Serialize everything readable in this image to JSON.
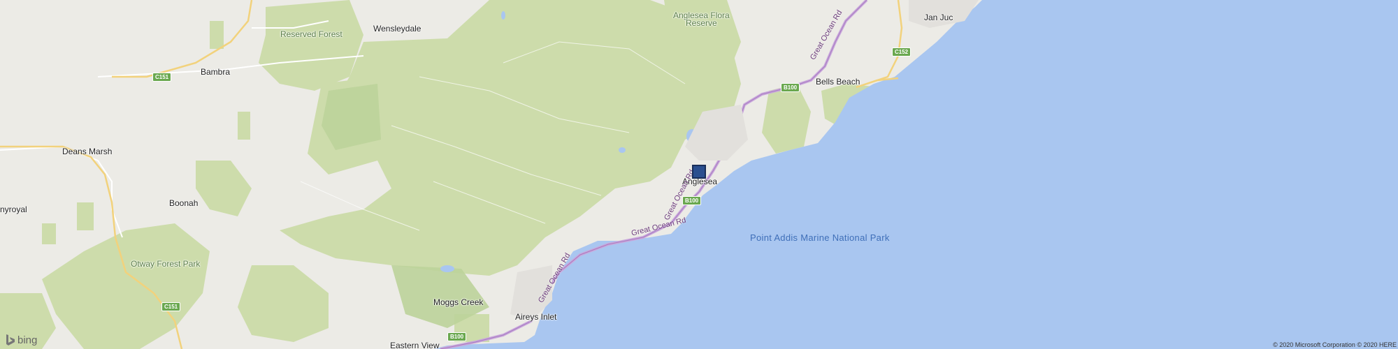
{
  "map": {
    "places": [
      {
        "id": "wensleydale",
        "label": "Wensleydale"
      },
      {
        "id": "bambra",
        "label": "Bambra"
      },
      {
        "id": "deans-marsh",
        "label": "Deans Marsh"
      },
      {
        "id": "boonah",
        "label": "Boonah"
      },
      {
        "id": "gnyroyal",
        "label": "nyroyal"
      },
      {
        "id": "moggs-creek",
        "label": "Moggs Creek"
      },
      {
        "id": "aireys-inlet",
        "label": "Aireys Inlet"
      },
      {
        "id": "eastern-view",
        "label": "Eastern View"
      },
      {
        "id": "anglesea",
        "label": "Anglesea"
      },
      {
        "id": "bells-beach",
        "label": "Bells Beach"
      },
      {
        "id": "jan-juc",
        "label": "Jan Juc"
      }
    ],
    "parks": [
      {
        "id": "reserved-forest",
        "label": "Reserved Forest"
      },
      {
        "id": "anglesea-flora-reserve-1",
        "label": "Anglesea Flora"
      },
      {
        "id": "anglesea-flora-reserve-2",
        "label": "Reserve"
      },
      {
        "id": "otway-forest-park",
        "label": "Otway Forest Park"
      }
    ],
    "water": [
      {
        "id": "point-addis",
        "label": "Point Addis Marine National Park"
      }
    ],
    "roads": [
      {
        "id": "great-ocean-rd-1",
        "label": "Great Ocean Rd"
      },
      {
        "id": "great-ocean-rd-2",
        "label": "Great Ocean Rd"
      },
      {
        "id": "great-ocean-rd-3",
        "label": "Great Ocean Rd"
      },
      {
        "id": "great-ocean-rd-4",
        "label": "Great Ocean Rd"
      }
    ],
    "shields": [
      {
        "id": "c151-a",
        "label": "C151"
      },
      {
        "id": "c151-b",
        "label": "C151"
      },
      {
        "id": "c152",
        "label": "C152"
      },
      {
        "id": "b100-a",
        "label": "B100"
      },
      {
        "id": "b100-b",
        "label": "B100"
      },
      {
        "id": "b100-c",
        "label": "B100"
      }
    ],
    "colors": {
      "land": "#ecebe6",
      "forest": "#cddcab",
      "forest_dark": "#bcd39a",
      "water": "#a9c6f0",
      "highway": "#c9a7dc",
      "major_road": "#f2d27c",
      "marker": "#2b4f8f"
    },
    "provider_logo": "bing",
    "copyright": "© 2020 Microsoft Corporation © 2020 HERE"
  }
}
